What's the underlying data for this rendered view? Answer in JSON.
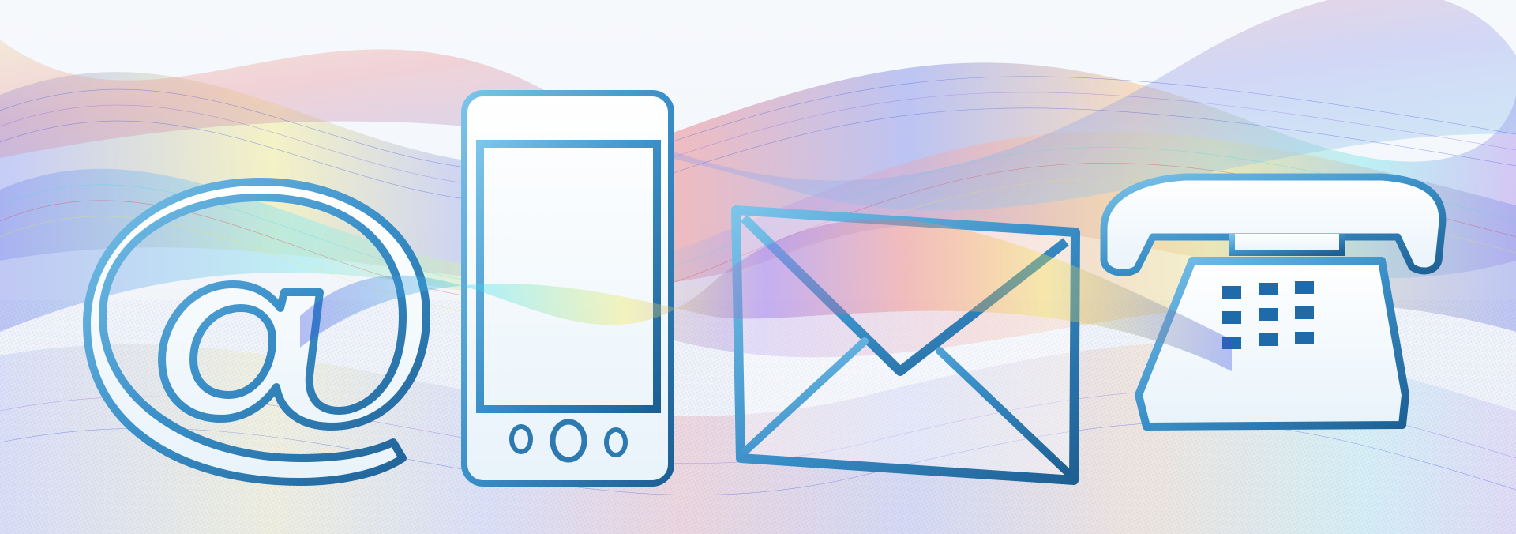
{
  "illustration": {
    "icons": [
      {
        "icon": "at-sign-icon"
      },
      {
        "icon": "smartphone-icon"
      },
      {
        "icon": "envelope-icon"
      },
      {
        "icon": "telephone-icon"
      }
    ],
    "colors": {
      "background": "#f3f7fb",
      "icon_fill": "#ffffff",
      "icon_edge": "#3a8fc8",
      "icon_edge_dark": "#1d5f93",
      "wave_blue": "#3b4fe0",
      "wave_violet": "#8a5ce6",
      "wave_yellow": "#f4e64a",
      "wave_red": "#e0363f",
      "wave_cyan": "#3de0e6",
      "wave_orange": "#f49a45",
      "mesh_line": "#9aa3d8"
    }
  }
}
